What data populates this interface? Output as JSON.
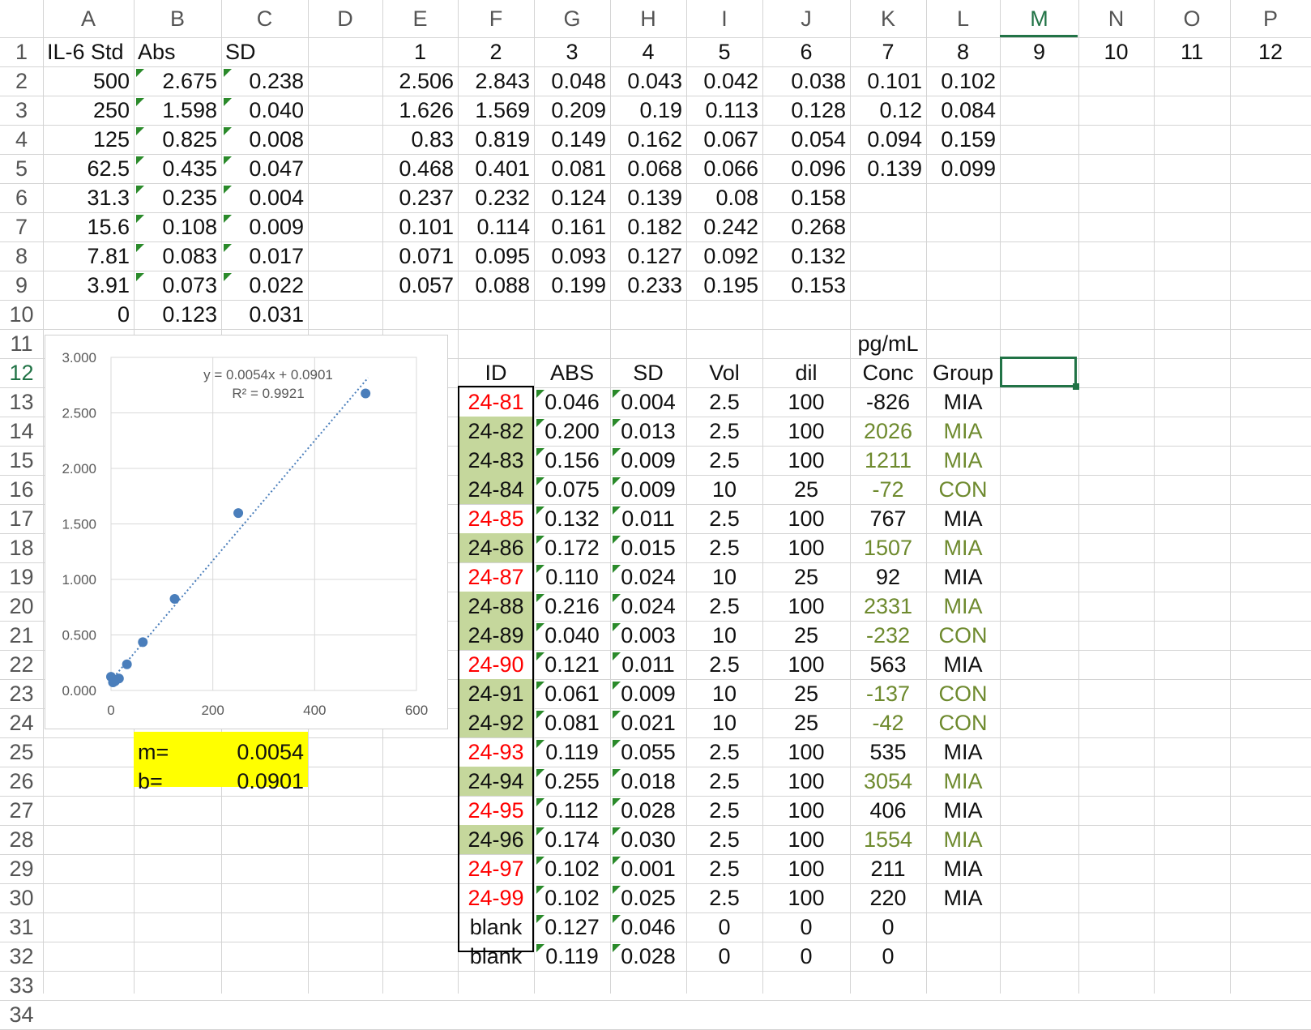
{
  "sheet": {
    "columns": [
      "A",
      "B",
      "C",
      "D",
      "E",
      "F",
      "G",
      "H",
      "I",
      "J",
      "K",
      "L",
      "M",
      "N",
      "O",
      "P"
    ],
    "rows": [
      "1",
      "2",
      "3",
      "4",
      "5",
      "6",
      "7",
      "8",
      "9",
      "10",
      "11",
      "12",
      "13",
      "14",
      "15",
      "16",
      "17",
      "18",
      "19",
      "20",
      "21",
      "22",
      "23",
      "24",
      "25",
      "26",
      "27",
      "28",
      "29",
      "30",
      "31",
      "32",
      "33",
      "34"
    ],
    "selected_column": "M",
    "selected_row": "12"
  },
  "standards": {
    "headers": {
      "std": "IL-6 Std",
      "abs": "Abs",
      "sd": "SD"
    },
    "rows": [
      {
        "std": "500",
        "abs": "2.675",
        "sd": "0.238"
      },
      {
        "std": "250",
        "abs": "1.598",
        "sd": "0.040"
      },
      {
        "std": "125",
        "abs": "0.825",
        "sd": "0.008"
      },
      {
        "std": "62.5",
        "abs": "0.435",
        "sd": "0.047"
      },
      {
        "std": "31.3",
        "abs": "0.235",
        "sd": "0.004"
      },
      {
        "std": "15.6",
        "abs": "0.108",
        "sd": "0.009"
      },
      {
        "std": "7.81",
        "abs": "0.083",
        "sd": "0.017"
      },
      {
        "std": "3.91",
        "abs": "0.073",
        "sd": "0.022"
      },
      {
        "std": "0",
        "abs": "0.123",
        "sd": "0.031"
      }
    ]
  },
  "plate": {
    "headers": [
      "1",
      "2",
      "3",
      "4",
      "5",
      "6",
      "7",
      "8",
      "9",
      "10",
      "11",
      "12"
    ],
    "rows": [
      [
        "2.506",
        "2.843",
        "0.048",
        "0.043",
        "0.042",
        "0.038",
        "0.101",
        "0.102"
      ],
      [
        "1.626",
        "1.569",
        "0.209",
        "0.19",
        "0.113",
        "0.128",
        "0.12",
        "0.084"
      ],
      [
        "0.83",
        "0.819",
        "0.149",
        "0.162",
        "0.067",
        "0.054",
        "0.094",
        "0.159"
      ],
      [
        "0.468",
        "0.401",
        "0.081",
        "0.068",
        "0.066",
        "0.096",
        "0.139",
        "0.099"
      ],
      [
        "0.237",
        "0.232",
        "0.124",
        "0.139",
        "0.08",
        "0.158"
      ],
      [
        "0.101",
        "0.114",
        "0.161",
        "0.182",
        "0.242",
        "0.268"
      ],
      [
        "0.071",
        "0.095",
        "0.093",
        "0.127",
        "0.092",
        "0.132"
      ],
      [
        "0.057",
        "0.088",
        "0.199",
        "0.233",
        "0.195",
        "0.153"
      ]
    ]
  },
  "samples": {
    "unit_label": "pg/mL",
    "headers": {
      "id": "ID",
      "abs": "ABS",
      "sd": "SD",
      "vol": "Vol",
      "dil": "dil",
      "conc": "Conc",
      "group": "Group"
    },
    "rows": [
      {
        "id": "24-81",
        "abs": "0.046",
        "sd": "0.004",
        "vol": "2.5",
        "dil": "100",
        "conc": "-826",
        "group": "MIA",
        "style": "red"
      },
      {
        "id": "24-82",
        "abs": "0.200",
        "sd": "0.013",
        "vol": "2.5",
        "dil": "100",
        "conc": "2026",
        "group": "MIA",
        "style": "green"
      },
      {
        "id": "24-83",
        "abs": "0.156",
        "sd": "0.009",
        "vol": "2.5",
        "dil": "100",
        "conc": "1211",
        "group": "MIA",
        "style": "green"
      },
      {
        "id": "24-84",
        "abs": "0.075",
        "sd": "0.009",
        "vol": "10",
        "dil": "25",
        "conc": "-72",
        "group": "CON",
        "style": "green"
      },
      {
        "id": "24-85",
        "abs": "0.132",
        "sd": "0.011",
        "vol": "2.5",
        "dil": "100",
        "conc": "767",
        "group": "MIA",
        "style": "red"
      },
      {
        "id": "24-86",
        "abs": "0.172",
        "sd": "0.015",
        "vol": "2.5",
        "dil": "100",
        "conc": "1507",
        "group": "MIA",
        "style": "green"
      },
      {
        "id": "24-87",
        "abs": "0.110",
        "sd": "0.024",
        "vol": "10",
        "dil": "25",
        "conc": "92",
        "group": "MIA",
        "style": "red"
      },
      {
        "id": "24-88",
        "abs": "0.216",
        "sd": "0.024",
        "vol": "2.5",
        "dil": "100",
        "conc": "2331",
        "group": "MIA",
        "style": "green"
      },
      {
        "id": "24-89",
        "abs": "0.040",
        "sd": "0.003",
        "vol": "10",
        "dil": "25",
        "conc": "-232",
        "group": "CON",
        "style": "green"
      },
      {
        "id": "24-90",
        "abs": "0.121",
        "sd": "0.011",
        "vol": "2.5",
        "dil": "100",
        "conc": "563",
        "group": "MIA",
        "style": "red"
      },
      {
        "id": "24-91",
        "abs": "0.061",
        "sd": "0.009",
        "vol": "10",
        "dil": "25",
        "conc": "-137",
        "group": "CON",
        "style": "green"
      },
      {
        "id": "24-92",
        "abs": "0.081",
        "sd": "0.021",
        "vol": "10",
        "dil": "25",
        "conc": "-42",
        "group": "CON",
        "style": "green"
      },
      {
        "id": "24-93",
        "abs": "0.119",
        "sd": "0.055",
        "vol": "2.5",
        "dil": "100",
        "conc": "535",
        "group": "MIA",
        "style": "red"
      },
      {
        "id": "24-94",
        "abs": "0.255",
        "sd": "0.018",
        "vol": "2.5",
        "dil": "100",
        "conc": "3054",
        "group": "MIA",
        "style": "green"
      },
      {
        "id": "24-95",
        "abs": "0.112",
        "sd": "0.028",
        "vol": "2.5",
        "dil": "100",
        "conc": "406",
        "group": "MIA",
        "style": "red"
      },
      {
        "id": "24-96",
        "abs": "0.174",
        "sd": "0.030",
        "vol": "2.5",
        "dil": "100",
        "conc": "1554",
        "group": "MIA",
        "style": "green"
      },
      {
        "id": "24-97",
        "abs": "0.102",
        "sd": "0.001",
        "vol": "2.5",
        "dil": "100",
        "conc": "211",
        "group": "MIA",
        "style": "red"
      },
      {
        "id": "24-99",
        "abs": "0.102",
        "sd": "0.025",
        "vol": "2.5",
        "dil": "100",
        "conc": "220",
        "group": "MIA",
        "style": "red"
      },
      {
        "id": "blank",
        "abs": "0.127",
        "sd": "0.046",
        "vol": "0",
        "dil": "0",
        "conc": "0",
        "group": "",
        "style": "plain"
      },
      {
        "id": "blank",
        "abs": "0.119",
        "sd": "0.028",
        "vol": "0",
        "dil": "0",
        "conc": "0",
        "group": "",
        "style": "plain"
      }
    ]
  },
  "coefficients": {
    "m_label": "m=",
    "m_value": "0.0054",
    "b_label": "b=",
    "b_value": "0.0901"
  },
  "colors": {
    "selection": "#217346",
    "red_text": "#ff0000",
    "green_text": "#6e8a2e",
    "green_fill": "#c5d79c",
    "yellow_fill": "#ffff00",
    "series": "#4a7ebb"
  },
  "chart_data": {
    "type": "scatter",
    "series": [
      {
        "x": [
          500,
          250,
          125,
          62.5,
          31.3,
          15.6,
          7.81,
          3.91,
          0
        ],
        "y": [
          2.675,
          1.598,
          0.825,
          0.435,
          0.235,
          0.108,
          0.083,
          0.073,
          0.123
        ]
      }
    ],
    "trendline": {
      "type": "linear",
      "slope": 0.0054,
      "intercept": 0.0901,
      "style": "dotted"
    },
    "equation_label": "y = 0.0054x + 0.0901",
    "r2_label": "R² = 0.9921",
    "xlim": [
      0,
      600
    ],
    "ylim": [
      0,
      3
    ],
    "x_ticks": [
      "0",
      "200",
      "400",
      "600"
    ],
    "y_ticks": [
      "0.000",
      "0.500",
      "1.000",
      "1.500",
      "2.000",
      "2.500",
      "3.000"
    ],
    "grid": true
  }
}
